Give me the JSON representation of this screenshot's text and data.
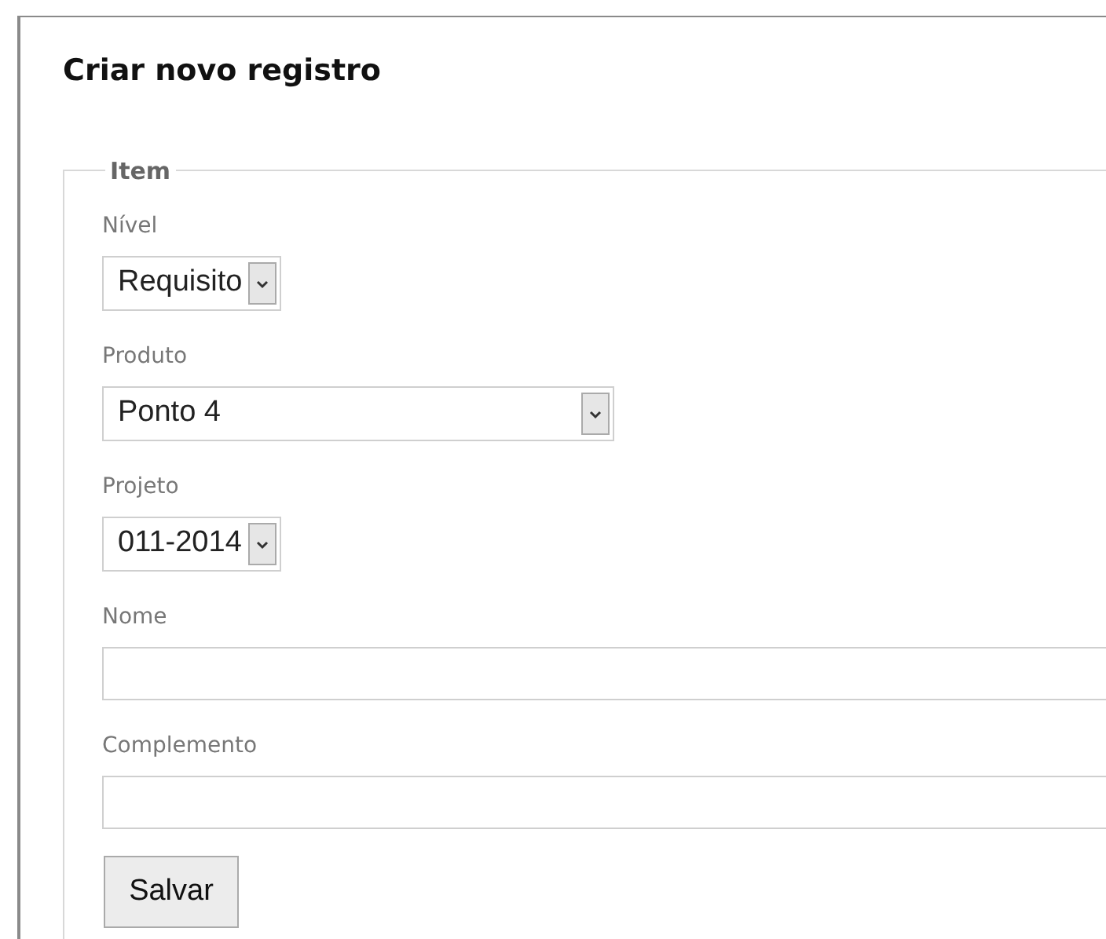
{
  "title": "Criar novo registro",
  "fieldset": {
    "legend": "Item",
    "fields": [
      {
        "kind": "select",
        "label": "Nível",
        "value": "Requisito"
      },
      {
        "kind": "wideselect",
        "label": "Produto",
        "value": "Ponto 4"
      },
      {
        "kind": "select",
        "label": "Projeto",
        "value": "011-2014"
      },
      {
        "kind": "text",
        "label": "Nome"
      },
      {
        "kind": "text",
        "label": "Complemento"
      }
    ],
    "button": "Salvar"
  }
}
